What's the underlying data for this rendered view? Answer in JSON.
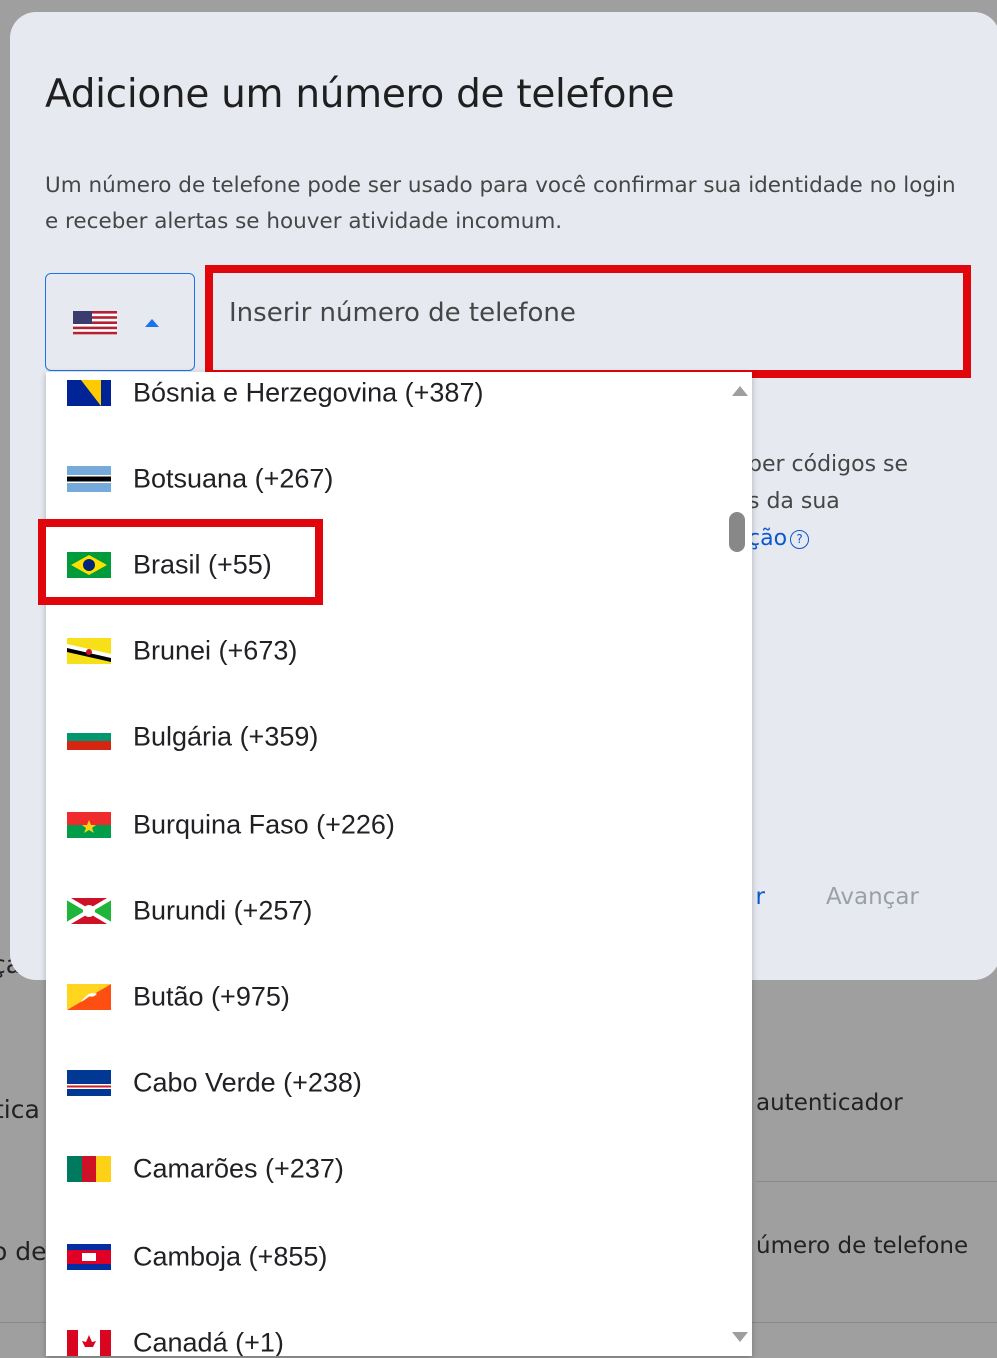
{
  "background": {
    "fragments": [
      "ça",
      "tica",
      "o de"
    ],
    "right_fragments": [
      "autenticador",
      "úmero de telefone"
    ]
  },
  "dialog": {
    "title": "Adicione um número de telefone",
    "description": "Um número de telefone pode ser usado para você confirmar sua identidade no login e receber alertas se houver atividade incomum.",
    "selected_country_flag": "us-flag-icon",
    "phone_input": {
      "value": "",
      "placeholder": "Inserir número de telefone"
    },
    "side_text_lines": [
      "ber códigos se",
      "s da sua"
    ],
    "side_link": "ção",
    "cancel_button": "r",
    "next_button": "Avançar"
  },
  "dropdown": {
    "options": [
      {
        "label": "Bósnia e Herzegovina (+387)",
        "flag": "bosnia-flag-icon"
      },
      {
        "label": "Botsuana (+267)",
        "flag": "botswana-flag-icon"
      },
      {
        "label": "Brasil (+55)",
        "flag": "brazil-flag-icon",
        "highlighted": true
      },
      {
        "label": "Brunei (+673)",
        "flag": "brunei-flag-icon"
      },
      {
        "label": "Bulgária (+359)",
        "flag": "bulgaria-flag-icon"
      },
      {
        "label": "Burquina Faso (+226)",
        "flag": "burkina-faso-flag-icon"
      },
      {
        "label": "Burundi (+257)",
        "flag": "burundi-flag-icon"
      },
      {
        "label": "Butão (+975)",
        "flag": "bhutan-flag-icon"
      },
      {
        "label": "Cabo Verde (+238)",
        "flag": "cape-verde-flag-icon"
      },
      {
        "label": "Camarões (+237)",
        "flag": "cameroon-flag-icon"
      },
      {
        "label": "Camboja (+855)",
        "flag": "cambodia-flag-icon"
      },
      {
        "label": "Canadá (+1)",
        "flag": "canada-flag-icon"
      }
    ]
  },
  "colors": {
    "accent_blue": "#1a73e8",
    "link_blue": "#0b57d0",
    "highlight_red": "#e0060b",
    "dialog_bg": "#e7e9f1"
  }
}
